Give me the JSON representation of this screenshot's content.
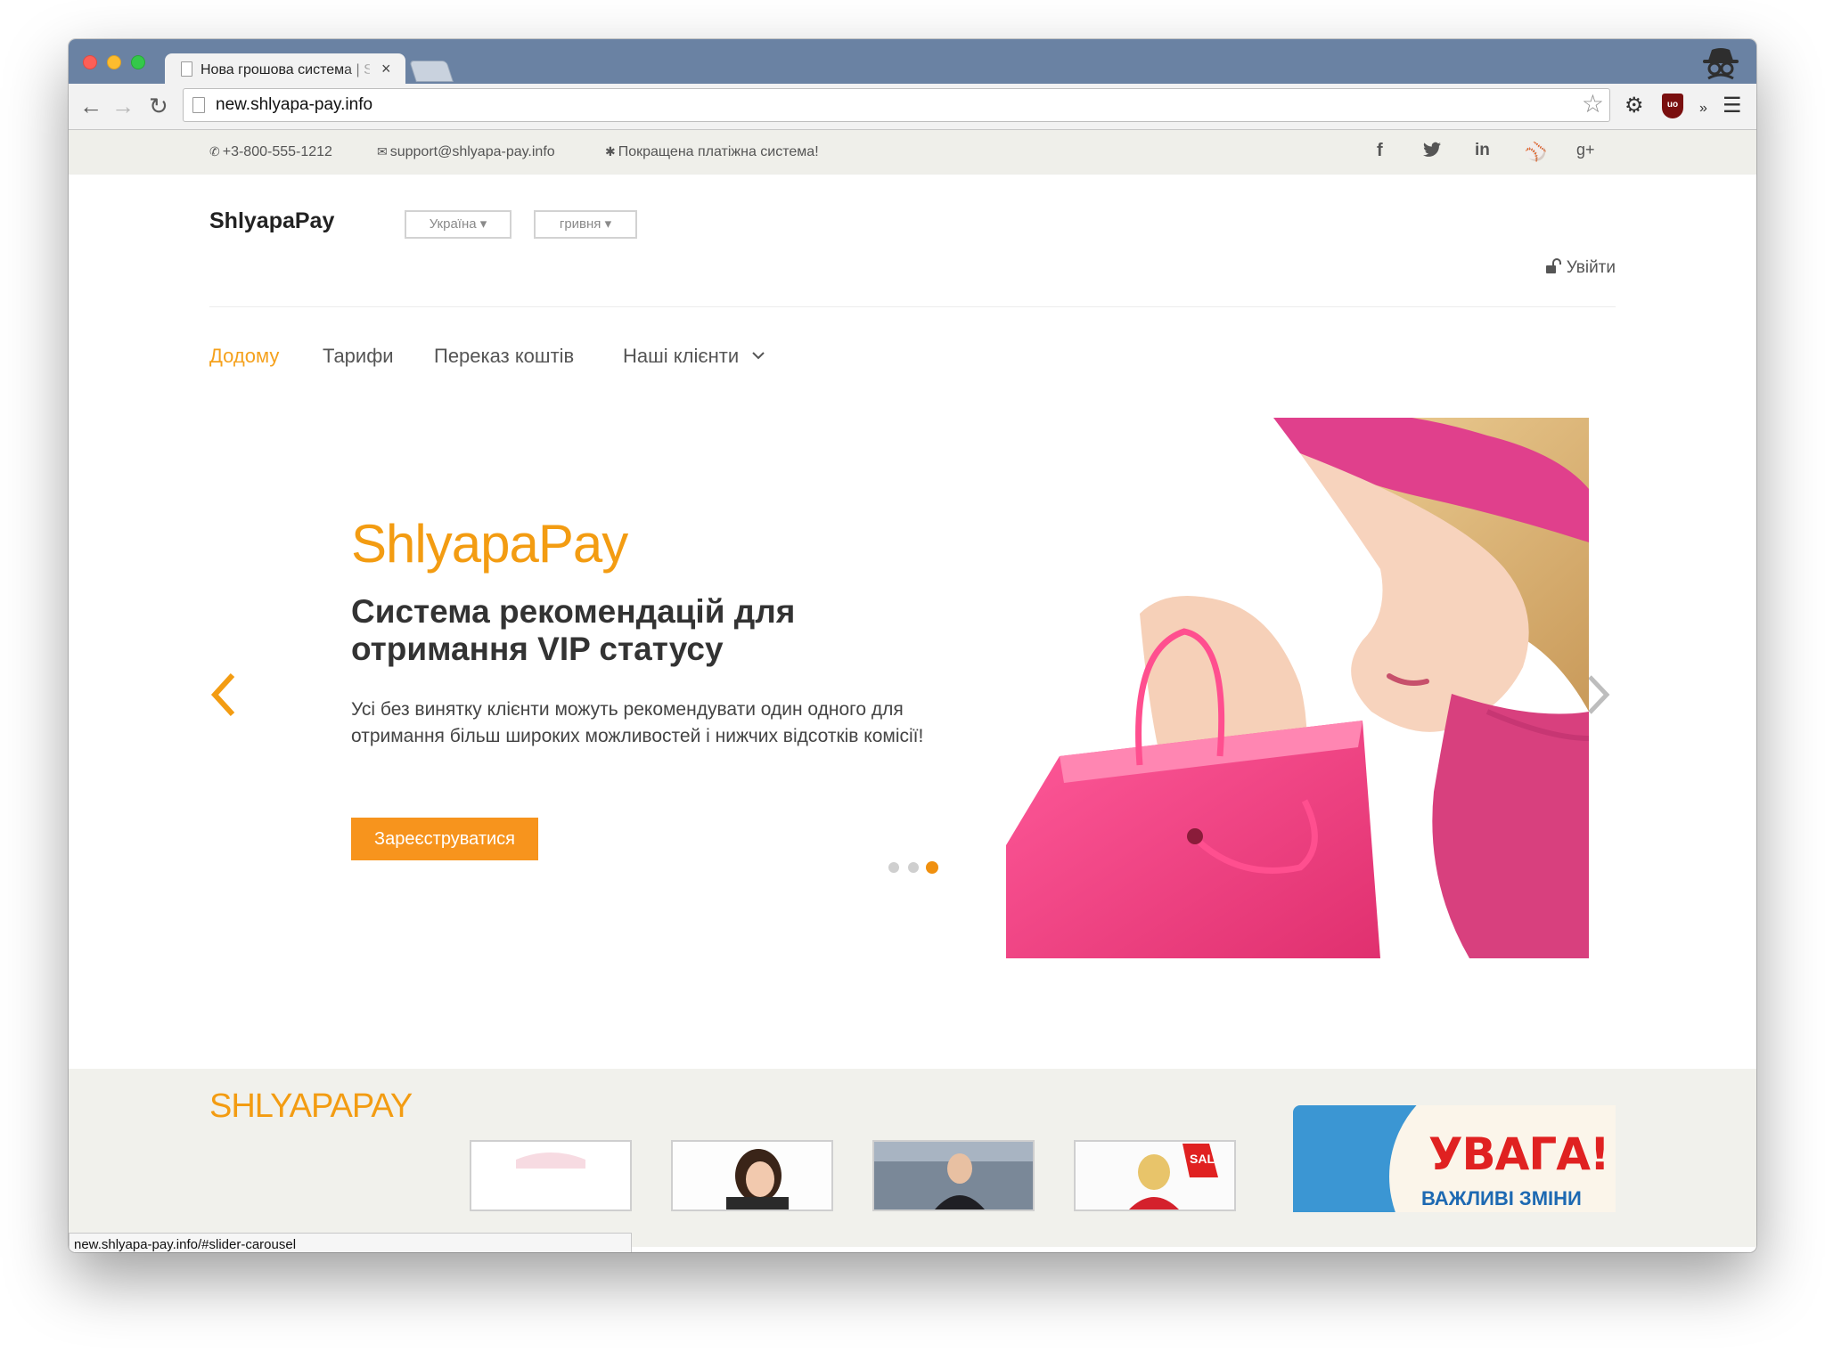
{
  "browser": {
    "tab_title": "Нова грошова система | S",
    "tab_close": "×",
    "url": "new.shlyapa-pay.info",
    "status_url": "new.shlyapa-pay.info/#slider-carousel",
    "colors": {
      "chrome": "#6a82a3",
      "close": "#fc5f57",
      "minimize": "#fdbc2e",
      "zoom": "#34c84a"
    }
  },
  "topbar": {
    "phone": "+3-800-555-1212",
    "email": "support@shlyapa-pay.info",
    "slogan": "Покращена платіжна система!",
    "social_icons": [
      "facebook-icon",
      "twitter-icon",
      "linkedin-icon",
      "dribbble-icon",
      "google-plus-icon"
    ],
    "social_glyphs": {
      "facebook": "f",
      "linkedin": "in",
      "google_plus": "g+"
    }
  },
  "header": {
    "brand": "ShlyapaPay",
    "country": "Україна",
    "currency": "гривня",
    "login": "Увійти"
  },
  "nav": {
    "items": [
      {
        "label": "Додому",
        "active": true
      },
      {
        "label": "Тарифи"
      },
      {
        "label": "Переказ коштів"
      },
      {
        "label": "Наші клієнти"
      }
    ]
  },
  "slider": {
    "brand": "ShlyapaPay",
    "title": "Система рекомендацій для отримання VIP статусу",
    "text": "Усі без винятку клієнти можуть рекомендувати один одного для отримання більш широких можливостей і нижчих відсотків комісії!",
    "cta": "Зареєструватися",
    "slide_count": 3,
    "active_slide": 3,
    "accent": "#f7941d"
  },
  "bottom": {
    "logo": "SHLYAPAPAY",
    "promo_title": "УВАГА!",
    "promo_subtitle": "ВАЖЛИВІ ЗМІНИ",
    "sale_tag": "SAL"
  }
}
